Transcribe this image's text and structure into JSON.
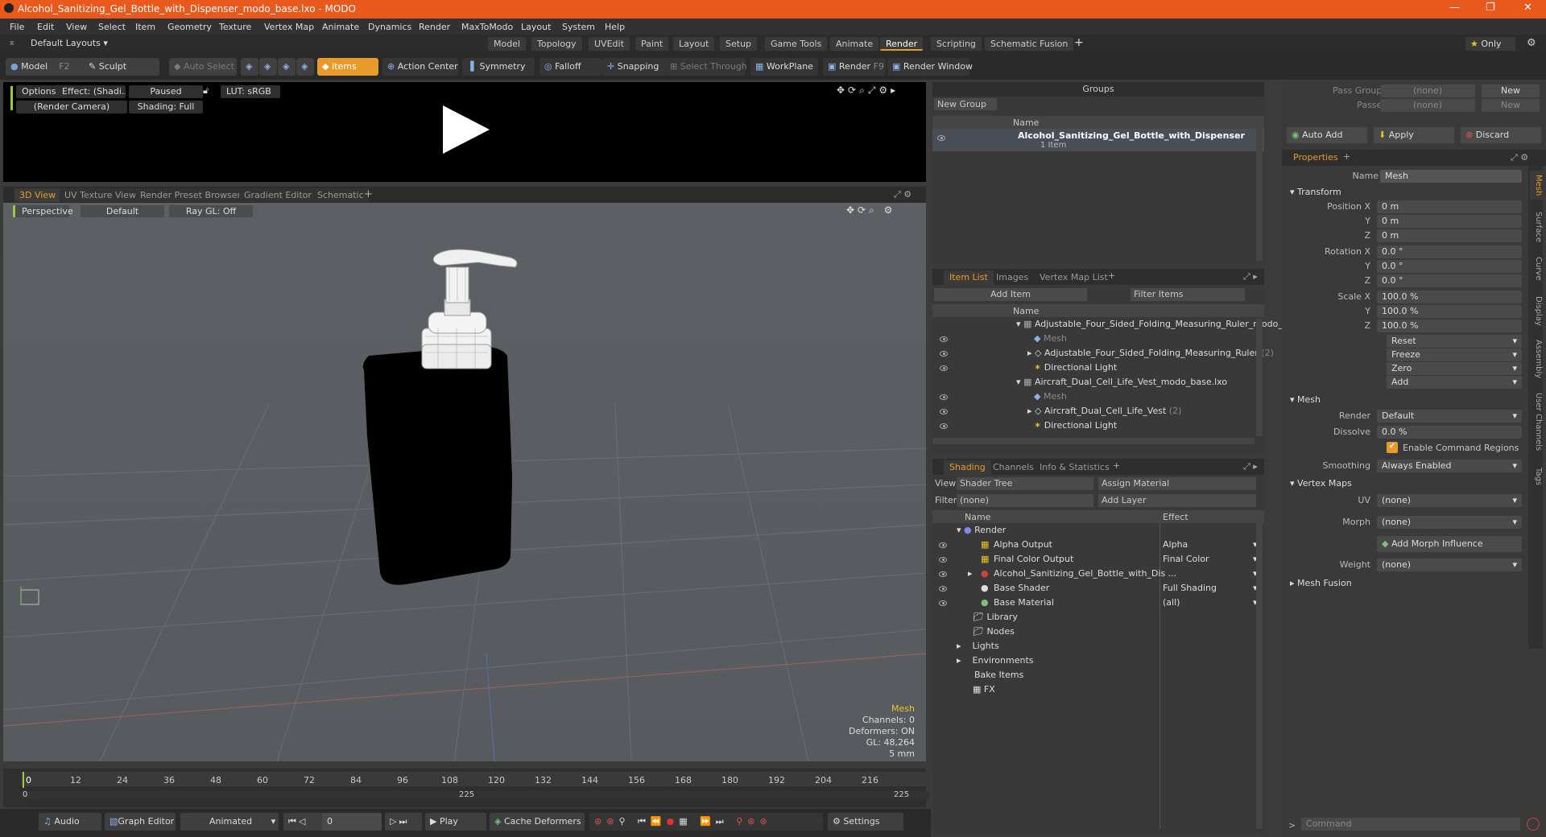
{
  "window": {
    "title": "Alcohol_Sanitizing_Gel_Bottle_with_Dispenser_modo_base.lxo - MODO"
  },
  "menu": [
    "File",
    "Edit",
    "View",
    "Select",
    "Item",
    "Geometry",
    "Texture",
    "Vertex Map",
    "Animate",
    "Dynamics",
    "Render",
    "MaxToModo",
    "Layout",
    "System",
    "Help"
  ],
  "layouts": {
    "dropdown": "Default Layouts",
    "tabs": [
      "Model",
      "Topology",
      "UVEdit",
      "Paint",
      "Layout",
      "Setup",
      "Game Tools",
      "Animate",
      "Render",
      "Scripting",
      "Schematic Fusion"
    ],
    "active": "Render",
    "only": "Only"
  },
  "toolbar": {
    "model": "Model",
    "model_key": "F2",
    "sculpt": "Sculpt",
    "auto_select": "Auto Select",
    "items": "Items",
    "action_center": "Action Center",
    "symmetry": "Symmetry",
    "falloff": "Falloff",
    "snapping": "Snapping",
    "select_through": "Select Through",
    "workplane": "WorkPlane",
    "render": "Render",
    "render_key": "F9",
    "render_window": "Render Window"
  },
  "preview": {
    "options": "Options",
    "effect": "Effect: (Shadi...",
    "paused": "Paused",
    "lut": "LUT: sRGB",
    "camera": "(Render Camera)",
    "shading": "Shading: Full"
  },
  "viewport_tabs": [
    "3D View",
    "UV Texture View",
    "Render Preset Browser",
    "Gradient Editor",
    "Schematic"
  ],
  "viewport": {
    "perspective": "Perspective",
    "default": "Default",
    "raygl": "Ray GL: Off",
    "info": {
      "mesh": "Mesh",
      "channels": "Channels: 0",
      "deformers": "Deformers: ON",
      "gl": "GL: 48,264",
      "size": "5 mm"
    }
  },
  "timeline": {
    "ticks": [
      "0",
      "12",
      "24",
      "36",
      "48",
      "60",
      "72",
      "84",
      "96",
      "108",
      "120",
      "132",
      "144",
      "156",
      "168",
      "180",
      "192",
      "204",
      "216"
    ],
    "start": "0",
    "mid": "225",
    "end": "225"
  },
  "bottom": {
    "audio": "Audio",
    "graph_editor": "Graph Editor",
    "animated": "Animated",
    "frame": "0",
    "play": "Play",
    "cache": "Cache Deformers",
    "settings": "Settings"
  },
  "groups": {
    "title": "Groups",
    "new_group": "New Group",
    "col_name": "Name",
    "item_name": "Alcohol_Sanitizing_Gel_Bottle_with_Dispenser",
    "item_count": "1 Item"
  },
  "itemlist": {
    "tabs": [
      "Item List",
      "Images",
      "Vertex Map List"
    ],
    "add_item": "Add Item",
    "filter": "Filter Items",
    "col_name": "Name",
    "rows": [
      {
        "label": "Adjustable_Four_Sided_Folding_Measuring_Ruler_modo_b...",
        "count": ""
      },
      {
        "label": "Mesh",
        "count": ""
      },
      {
        "label": "Adjustable_Four_Sided_Folding_Measuring_Ruler",
        "count": "(2)"
      },
      {
        "label": "Directional Light",
        "count": ""
      },
      {
        "label": "Aircraft_Dual_Cell_Life_Vest_modo_base.lxo",
        "count": ""
      },
      {
        "label": "Mesh",
        "count": ""
      },
      {
        "label": "Aircraft_Dual_Cell_Life_Vest",
        "count": "(2)"
      },
      {
        "label": "Directional Light",
        "count": ""
      }
    ]
  },
  "shading": {
    "tabs": [
      "Shading",
      "Channels",
      "Info & Statistics"
    ],
    "view_label": "View",
    "view": "Shader Tree",
    "assign": "Assign Material",
    "filter_label": "Filter",
    "filter": "(none)",
    "add_layer": "Add Layer",
    "col_name": "Name",
    "col_effect": "Effect",
    "rows": [
      {
        "name": "Render",
        "effect": ""
      },
      {
        "name": "Alpha Output",
        "effect": "Alpha"
      },
      {
        "name": "Final Color Output",
        "effect": "Final Color"
      },
      {
        "name": "Alcohol_Sanitizing_Gel_Bottle_with_Dis ...",
        "effect": ""
      },
      {
        "name": "Base Shader",
        "effect": "Full Shading"
      },
      {
        "name": "Base Material",
        "effect": "(all)"
      },
      {
        "name": "Library",
        "effect": ""
      },
      {
        "name": "Nodes",
        "effect": ""
      },
      {
        "name": "Lights",
        "effect": ""
      },
      {
        "name": "Environments",
        "effect": ""
      },
      {
        "name": "Bake Items",
        "effect": ""
      },
      {
        "name": "FX",
        "effect": ""
      }
    ]
  },
  "props": {
    "pass_groups": "Pass Groups",
    "passes": "Passes",
    "none": "(none)",
    "new": "New",
    "auto_add": "Auto Add",
    "apply": "Apply",
    "discard": "Discard",
    "tab": "Properties",
    "name_label": "Name",
    "name": "Mesh",
    "transform": "Transform",
    "pos_label": "Position X",
    "rot_label": "Rotation X",
    "scale_label": "Scale X",
    "y": "Y",
    "z": "Z",
    "pos": [
      "0 m",
      "0 m",
      "0 m"
    ],
    "rot": [
      "0.0 °",
      "0.0 °",
      "0.0 °"
    ],
    "scale": [
      "100.0 %",
      "100.0 %",
      "100.0 %"
    ],
    "reset": "Reset",
    "freeze": "Freeze",
    "zero": "Zero",
    "add": "Add",
    "mesh": "Mesh",
    "render_label": "Render",
    "render": "Default",
    "dissolve_label": "Dissolve",
    "dissolve": "0.0 %",
    "enable_cmd": "Enable Command Regions",
    "smoothing_label": "Smoothing",
    "smoothing": "Always Enabled",
    "vmaps": "Vertex Maps",
    "uv_label": "UV",
    "uv": "(none)",
    "morph_label": "Morph",
    "morph": "(none)",
    "add_morph": "Add Morph Influence",
    "weight_label": "Weight",
    "weight": "(none)",
    "mesh_fusion": "Mesh Fusion",
    "side_tabs": [
      "Mesh",
      "Surface",
      "Curve",
      "Display",
      "Assembly",
      "User Channels",
      "Tags"
    ],
    "command": "Command"
  },
  "colors": {
    "accent": "#e89a2c",
    "title": "#e9581d",
    "bottle": "#000000"
  }
}
